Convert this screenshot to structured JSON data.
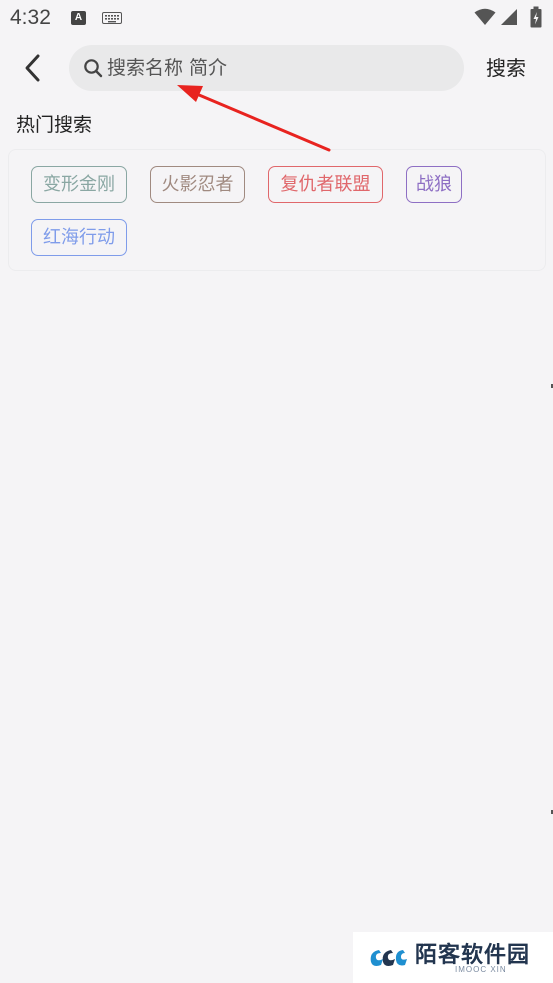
{
  "status_bar": {
    "time": "4:32",
    "icons": [
      "text-a-icon",
      "keyboard-icon",
      "wifi-icon",
      "signal-icon",
      "battery-icon"
    ]
  },
  "top_bar": {
    "back_icon": "chevron-left-icon",
    "search_placeholder": "搜索名称 简介",
    "search_value": "",
    "search_button_label": "搜索"
  },
  "hot_search": {
    "title": "热门搜索",
    "tags": [
      {
        "label": "变形金刚",
        "color": "#8aa7a3"
      },
      {
        "label": "火影忍者",
        "color": "#a08a80"
      },
      {
        "label": "复仇者联盟",
        "color": "#e0676b"
      },
      {
        "label": "战狼",
        "color": "#8e6fc4"
      },
      {
        "label": "红海行动",
        "color": "#7f9cea"
      }
    ]
  },
  "annotation": {
    "color": "#e8231f"
  },
  "watermark": {
    "text": "陌客软件园",
    "subtext": "IMOOC XIN",
    "color": "#22354f",
    "accent": "#1f8fd0"
  }
}
